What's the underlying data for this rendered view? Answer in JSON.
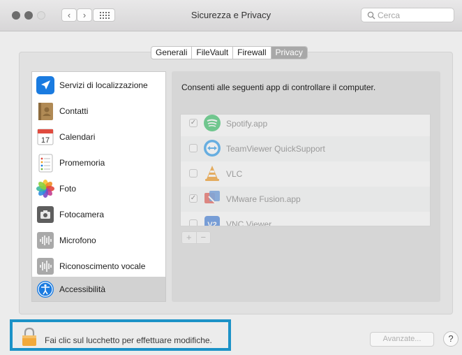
{
  "window": {
    "title": "Sicurezza e Privacy"
  },
  "toolbar": {
    "search_placeholder": "Cerca",
    "back": "‹",
    "forward": "›"
  },
  "tabs": [
    {
      "label": "Generali"
    },
    {
      "label": "FileVault"
    },
    {
      "label": "Firewall"
    },
    {
      "label": "Privacy",
      "active": true
    }
  ],
  "sidebar": {
    "items": [
      {
        "label": "Servizi di localizzazione",
        "icon": "location-arrow-icon"
      },
      {
        "label": "Contatti",
        "icon": "contacts-book-icon"
      },
      {
        "label": "Calendari",
        "icon": "calendar-icon",
        "icon_text": "17"
      },
      {
        "label": "Promemoria",
        "icon": "reminders-icon"
      },
      {
        "label": "Foto",
        "icon": "photos-flower-icon"
      },
      {
        "label": "Fotocamera",
        "icon": "camera-icon"
      },
      {
        "label": "Microfono",
        "icon": "microphone-waveform-icon"
      },
      {
        "label": "Riconoscimento vocale",
        "icon": "speech-waveform-icon"
      },
      {
        "label": "Accessibilità",
        "icon": "accessibility-icon",
        "selected": true
      }
    ]
  },
  "main": {
    "title": "Consenti alle seguenti app di controllare il computer.",
    "apps": [
      {
        "name": "Spotify.app",
        "checked": true,
        "icon": "spotify-icon"
      },
      {
        "name": "TeamViewer QuickSupport",
        "checked": false,
        "icon": "teamviewer-icon"
      },
      {
        "name": "VLC",
        "checked": false,
        "icon": "vlc-cone-icon"
      },
      {
        "name": "VMware Fusion.app",
        "checked": true,
        "icon": "vmware-fusion-icon"
      },
      {
        "name": "VNC Viewer",
        "checked": false,
        "icon": "vnc-viewer-icon",
        "icon_text": "V2"
      }
    ],
    "add_label": "+",
    "remove_label": "−"
  },
  "footer": {
    "lock_text": "Fai clic sul lucchetto per effettuare modifiche.",
    "advanced_label": "Avanzate...",
    "help_label": "?"
  },
  "colors": {
    "highlight_border": "#1c92c7",
    "close": "#6d6d6d",
    "minimize": "#6d6d6d",
    "zoom": "#dcdcdc",
    "tab_active": "#a8a8a8"
  }
}
